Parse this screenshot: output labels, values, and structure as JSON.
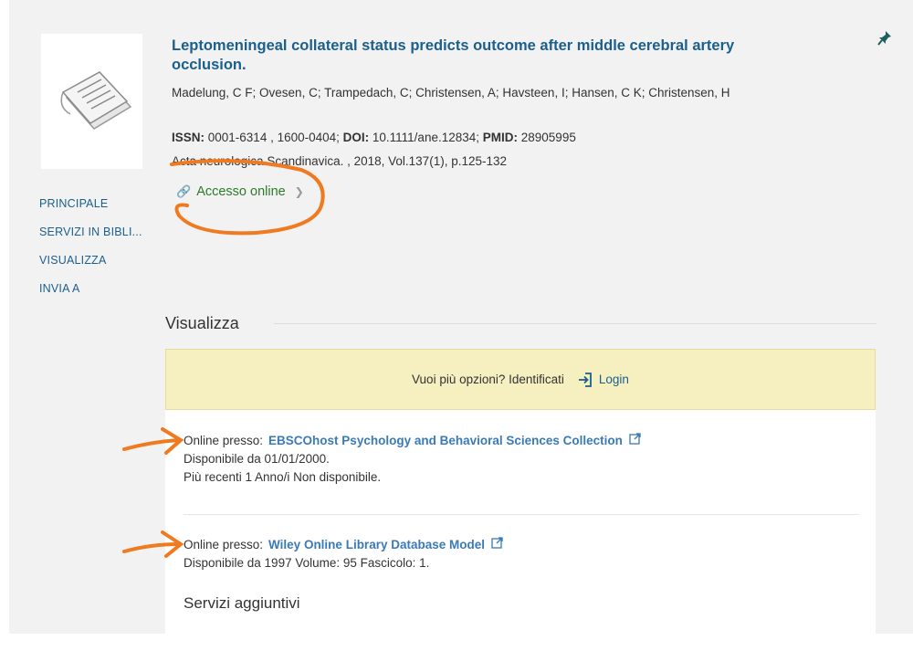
{
  "record": {
    "title": "Leptomeningeal collateral status predicts outcome after middle cerebral artery occlusion.",
    "authors": "Madelung, C F; Ovesen, C; Trampedach, C; Christensen, A; Havsteen, I; Hansen, C K; Christensen, H",
    "issn_label": "ISSN:",
    "issn_value": " 0001-6314 , 1600-0404; ",
    "doi_label": "DOI:",
    "doi_value": " 10.1111/ane.12834; ",
    "pmid_label": "PMID:",
    "pmid_value": " 28905995",
    "source": "Acta neurologica Scandinavica. , 2018, Vol.137(1), p.125-132",
    "access_label": "Accesso online"
  },
  "nav": {
    "items": [
      "PRINCIPALE",
      "SERVIZI IN BIBLI...",
      "VISUALIZZA",
      "INVIA A"
    ]
  },
  "section": {
    "title": "Visualizza"
  },
  "login_bar": {
    "prompt": "Vuoi più opzioni? Identificati",
    "login_label": "Login"
  },
  "links": [
    {
      "prefix": "Online presso:",
      "provider": "EBSCOhost Psychology and Behavioral Sciences Collection",
      "line1": "Disponibile da 01/01/2000.",
      "line2": "Più recenti 1 Anno/i Non disponibile."
    },
    {
      "prefix": "Online presso:",
      "provider": "Wiley Online Library Database Model",
      "line1": "Disponibile da 1997 Volume: 95 Fascicolo: 1."
    }
  ],
  "services": {
    "title": "Servizi aggiuntivi"
  },
  "colors": {
    "link_blue": "#1b5f8c",
    "provider_blue": "#3a7ab7",
    "access_green": "#2a7a2a",
    "login_bg": "#f6efc0",
    "annotation_orange": "#f07a20"
  },
  "icons": {
    "pin": "pin-icon",
    "link": "link-icon",
    "login": "login-icon",
    "external": "external-link-icon",
    "document": "document-icon"
  }
}
